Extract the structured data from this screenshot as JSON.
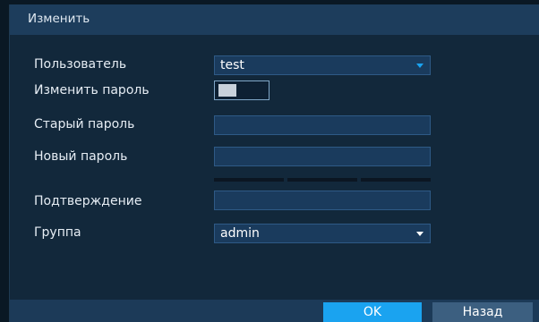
{
  "dialog": {
    "title": "Изменить"
  },
  "form": {
    "user_label": "Пользователь",
    "user_value": "test",
    "change_password_label": "Изменить пароль",
    "change_password_enabled": true,
    "old_password_label": "Старый пароль",
    "old_password_value": "",
    "new_password_label": "Новый пароль",
    "new_password_value": "",
    "confirm_label": "Подтверждение",
    "confirm_value": "",
    "group_label": "Группа",
    "group_value": "admin"
  },
  "footer": {
    "ok_label": "OK",
    "back_label": "Назад"
  },
  "colors": {
    "accent": "#1aa3f0",
    "panel": "#12283b",
    "header": "#1d3d5c"
  }
}
